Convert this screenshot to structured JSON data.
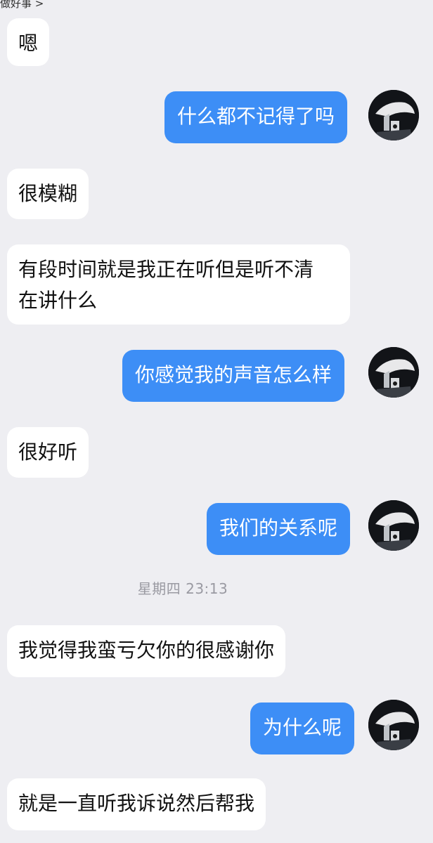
{
  "header": {
    "link_text": "做好事 >"
  },
  "messages": [
    {
      "side": "in",
      "text": "嗯"
    },
    {
      "side": "out",
      "text": "什么都不记得了吗"
    },
    {
      "side": "in",
      "text": "很模糊"
    },
    {
      "side": "in",
      "line1": "有段时间就是我正在听但是听不清",
      "line2": "在讲什么"
    },
    {
      "side": "out",
      "text": "你感觉我的声音怎么样"
    },
    {
      "side": "in",
      "text": "很好听"
    },
    {
      "side": "out",
      "text": "我们的关系呢"
    },
    {
      "side": "in",
      "text": "我觉得我蛮亏欠你的很感谢你"
    },
    {
      "side": "out",
      "text": "为什么呢"
    },
    {
      "side": "in",
      "text": "就是一直听我诉说然后帮我"
    }
  ],
  "timestamp": "星期四 23:13",
  "colors": {
    "background": "#eeeef2",
    "incoming_bubble": "#ffffff",
    "outgoing_bubble": "#3d8ef6",
    "timestamp_text": "#9a9aa2"
  },
  "icons": {
    "avatar": "user-avatar-icon"
  }
}
